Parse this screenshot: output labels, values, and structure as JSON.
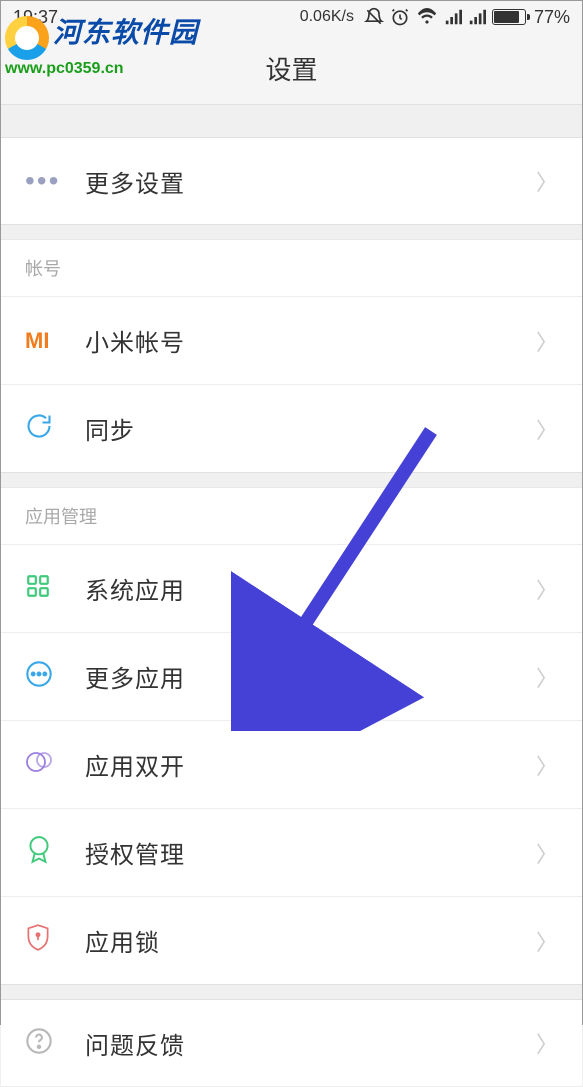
{
  "status": {
    "time": "19:37",
    "speed": "0.06K/s",
    "battery_pct": "77%"
  },
  "header": {
    "title": "设置"
  },
  "watermark": {
    "cn": "河东软件园",
    "url": "www.pc0359.cn"
  },
  "groups": {
    "g0": {
      "items": {
        "more_settings": "更多设置"
      }
    },
    "g1": {
      "label": "帐号",
      "items": {
        "mi_account": "小米帐号",
        "sync": "同步"
      }
    },
    "g2": {
      "label": "应用管理",
      "items": {
        "system_apps": "系统应用",
        "more_apps": "更多应用",
        "dual_apps": "应用双开",
        "permissions": "授权管理",
        "app_lock": "应用锁"
      }
    },
    "g3": {
      "items": {
        "feedback": "问题反馈"
      }
    }
  },
  "icons": {
    "mi_logo": "MI",
    "colors": {
      "mi_orange": "#f07c1e",
      "sync_blue": "#3aa7e8",
      "apps_green": "#3fc97a",
      "more_blue": "#3aa7e8",
      "dual_purple": "#9b7fe0",
      "badge_green": "#3fc97a",
      "lock_red": "#e87070",
      "help_gray": "#b8b8b8",
      "dots_gray": "#9aa0c0"
    }
  }
}
